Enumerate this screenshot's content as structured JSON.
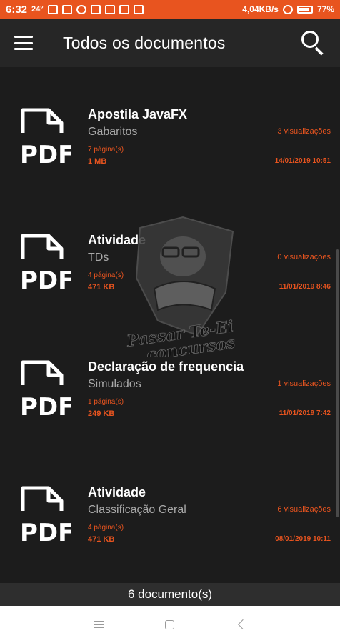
{
  "status_bar": {
    "time": "6:32",
    "temperature": "24°",
    "network_speed": "4,04KB/s",
    "battery": "77%"
  },
  "app_bar": {
    "title": "Todos os documentos",
    "menu_icon": "hamburger-menu-icon",
    "search_icon": "search-icon"
  },
  "documents": [
    {
      "title": "Apostila JavaFX",
      "category": "Gabaritos",
      "pages": "7 página(s)",
      "size": "1 MB",
      "views": "3 visualizações",
      "date": "14/01/2019 10:51",
      "icon": "pdf-file-icon"
    },
    {
      "title": "Atividade",
      "category": "TDs",
      "pages": "4 página(s)",
      "size": "471 KB",
      "views": "0 visualizações",
      "date": "11/01/2019 8:46",
      "icon": "pdf-file-icon"
    },
    {
      "title": "Declaração de frequencia",
      "category": "Simulados",
      "pages": "1 página(s)",
      "size": "249 KB",
      "views": "1 visualizações",
      "date": "11/01/2019 7:42",
      "icon": "pdf-file-icon"
    },
    {
      "title": "Atividade",
      "category": "Classificação Geral",
      "pages": "4 página(s)",
      "size": "471 KB",
      "views": "6 visualizações",
      "date": "08/01/2019 10:11",
      "icon": "pdf-file-icon"
    }
  ],
  "watermark": {
    "text_line1": "Passar Te-Ei",
    "text_line2": "concursos"
  },
  "footer": {
    "count_label": "6 documento(s)"
  },
  "colors": {
    "accent": "#e8541f",
    "background": "#1c1c1c",
    "app_bar": "#262626",
    "footer": "#2e2e2e"
  }
}
